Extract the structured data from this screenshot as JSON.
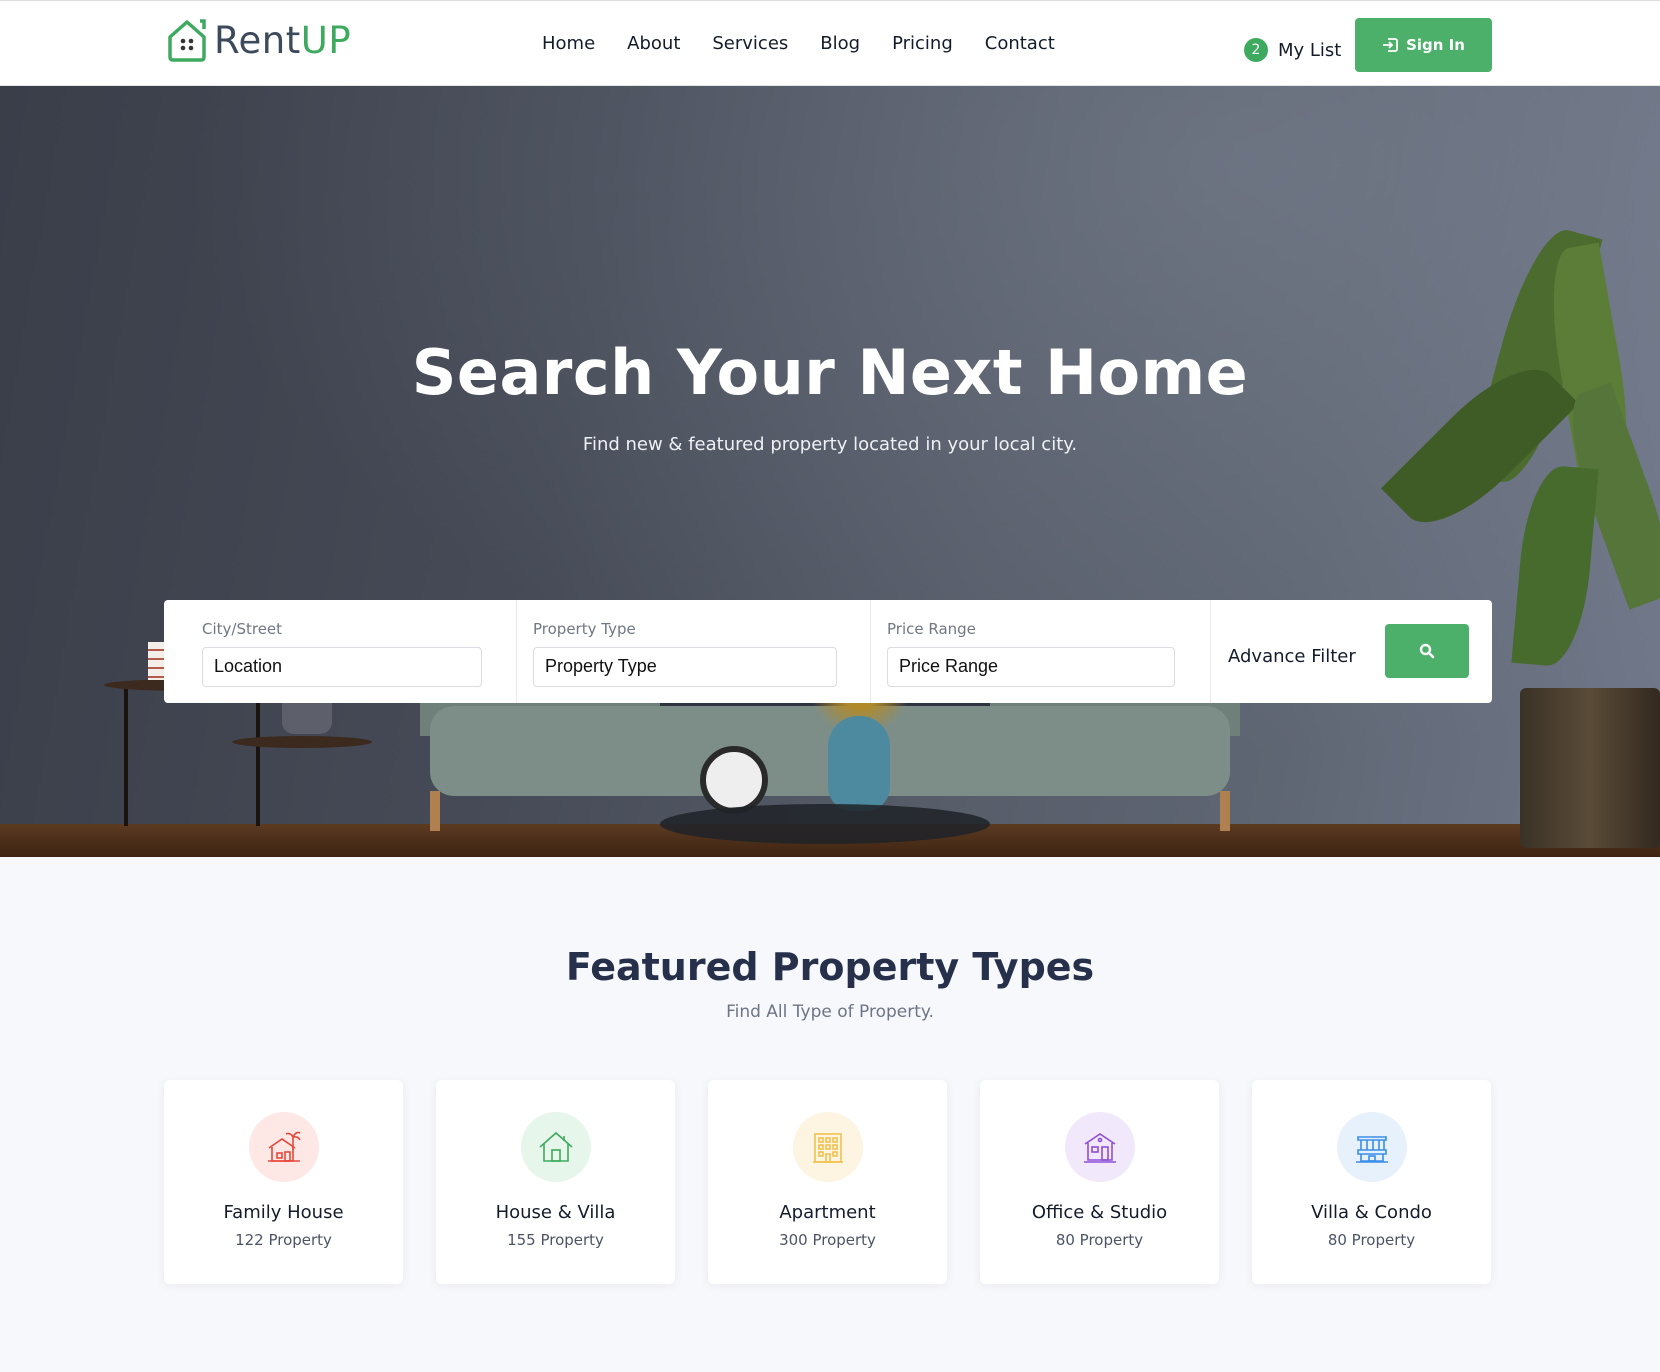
{
  "brand": {
    "name_part1": "Rent",
    "name_part2": "UP",
    "accent": "#3eaa5f"
  },
  "nav": [
    "Home",
    "About",
    "Services",
    "Blog",
    "Pricing",
    "Contact"
  ],
  "header": {
    "mylist_count": "2",
    "mylist_label": "My List",
    "signin_label": "Sign In",
    "signin_icon": "sign-in-icon"
  },
  "hero": {
    "title": "Search Your Next Home",
    "subtitle": "Find new & featured property located in your local city."
  },
  "search": {
    "city": {
      "label": "City/Street",
      "placeholder": "Location"
    },
    "type": {
      "label": "Property Type",
      "placeholder": "Property Type"
    },
    "price": {
      "label": "Price Range",
      "placeholder": "Price Range"
    },
    "advance_label": "Advance Filter",
    "button_icon": "search-icon",
    "button_color": "#4caf6a"
  },
  "featured": {
    "title": "Featured Property Types",
    "subtitle": "Find All Type of Property.",
    "items": [
      {
        "title": "Family House",
        "count": "122 Property",
        "icon": "beach-house-icon",
        "color": "#e8483b",
        "bg": "#fde8e6"
      },
      {
        "title": "House & Villa",
        "count": "155 Property",
        "icon": "house-icon",
        "color": "#3eaa5f",
        "bg": "#e6f6ea"
      },
      {
        "title": "Apartment",
        "count": "300 Property",
        "icon": "building-icon",
        "color": "#f2c14e",
        "bg": "#fdf4e1"
      },
      {
        "title": "Office & Studio",
        "count": "80 Property",
        "icon": "office-icon",
        "color": "#8e4fd6",
        "bg": "#f2e8fc"
      },
      {
        "title": "Villa & Condo",
        "count": "80 Property",
        "icon": "condo-icon",
        "color": "#3a8ee6",
        "bg": "#e7f1fc"
      }
    ]
  }
}
